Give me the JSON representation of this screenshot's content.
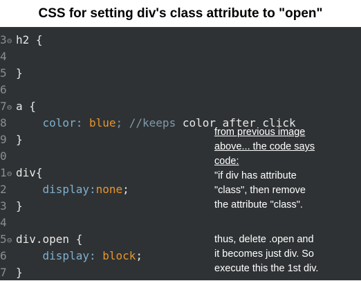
{
  "title": "CSS for setting div's class attribute to \"open\"",
  "lines": [
    {
      "n": "3",
      "fold": true,
      "code": [
        {
          "t": "h2 {",
          "c": "sel"
        }
      ]
    },
    {
      "n": "4",
      "fold": false,
      "code": []
    },
    {
      "n": "5",
      "fold": false,
      "code": [
        {
          "t": "}",
          "c": "brace"
        }
      ]
    },
    {
      "n": "6",
      "fold": false,
      "code": []
    },
    {
      "n": "7",
      "fold": true,
      "code": [
        {
          "t": "a {",
          "c": "sel"
        }
      ]
    },
    {
      "n": "8",
      "fold": false,
      "code": [
        {
          "t": "    color: ",
          "c": "prop"
        },
        {
          "t": "blue",
          "c": "val"
        },
        {
          "t": "; //keeps ",
          "c": "com"
        },
        {
          "t": "color after click",
          "c": "plain"
        }
      ]
    },
    {
      "n": "9",
      "fold": false,
      "code": [
        {
          "t": "}",
          "c": "brace"
        }
      ]
    },
    {
      "n": "0",
      "fold": false,
      "code": []
    },
    {
      "n": "1",
      "fold": true,
      "code": [
        {
          "t": "div{",
          "c": "sel"
        }
      ]
    },
    {
      "n": "2",
      "fold": false,
      "code": [
        {
          "t": "    display:",
          "c": "prop"
        },
        {
          "t": "none",
          "c": "val"
        },
        {
          "t": ";",
          "c": "plain"
        }
      ]
    },
    {
      "n": "3",
      "fold": false,
      "code": [
        {
          "t": "}",
          "c": "brace"
        }
      ]
    },
    {
      "n": "4",
      "fold": false,
      "code": []
    },
    {
      "n": "5",
      "fold": true,
      "code": [
        {
          "t": "div.open {",
          "c": "sel"
        }
      ]
    },
    {
      "n": "6",
      "fold": false,
      "code": [
        {
          "t": "    display: ",
          "c": "prop"
        },
        {
          "t": "block",
          "c": "val"
        },
        {
          "t": ";",
          "c": "plain"
        }
      ]
    },
    {
      "n": "7",
      "fold": false,
      "code": [
        {
          "t": "}",
          "c": "brace"
        }
      ]
    }
  ],
  "note1": {
    "underlined": [
      "from previous image",
      "above... the code says",
      "code:"
    ],
    "plain": [
      " \"if div has attribute",
      "\"class\", then remove",
      "the attribute \"class\"."
    ]
  },
  "note2": [
    "thus, delete .open  and",
    "it becomes just div. So",
    "execute this the 1st div."
  ]
}
